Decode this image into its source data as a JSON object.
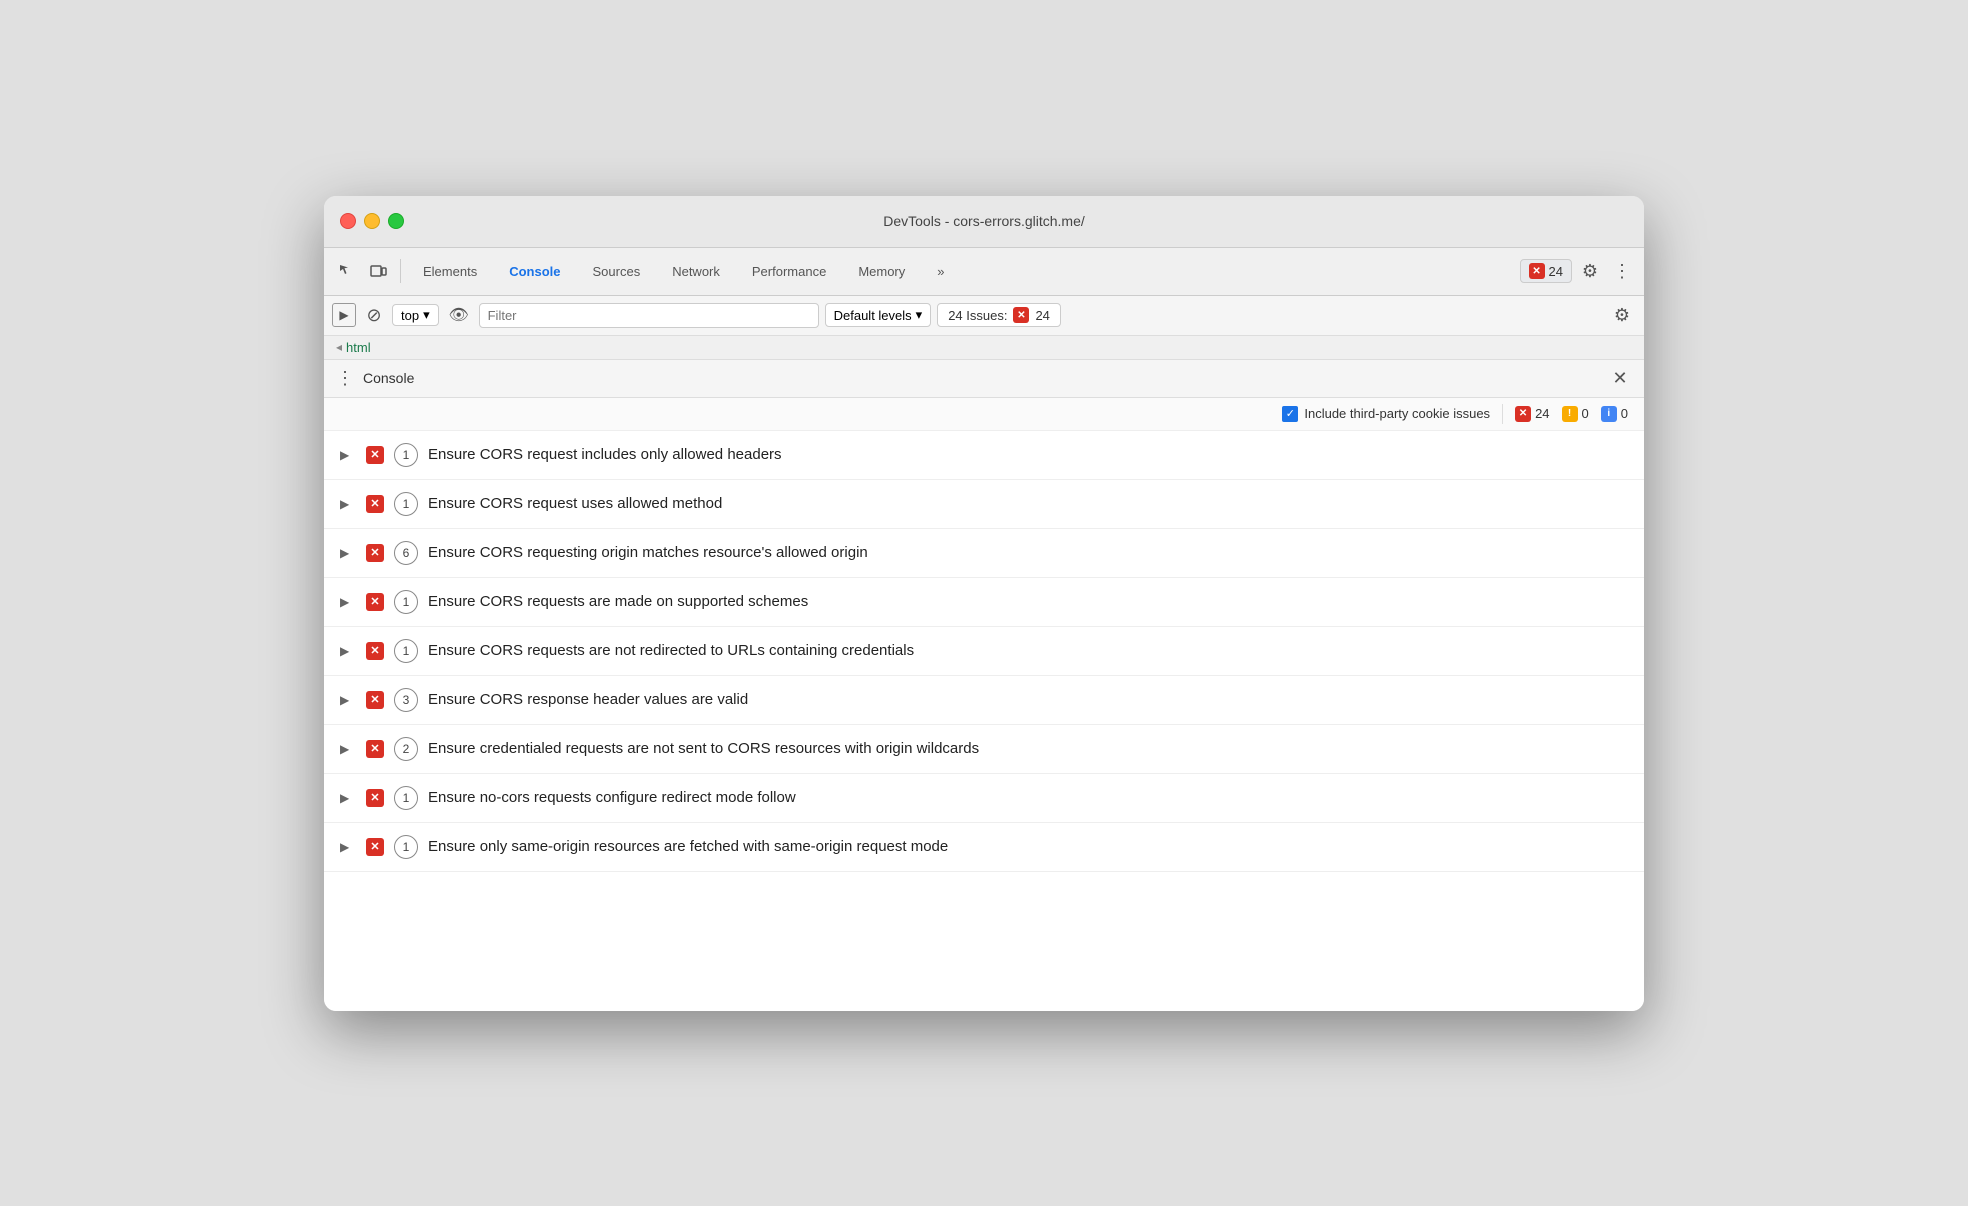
{
  "window": {
    "title": "DevTools - cors-errors.glitch.me/"
  },
  "toolbar": {
    "tabs": [
      {
        "label": "Elements",
        "active": false
      },
      {
        "label": "Console",
        "active": true
      },
      {
        "label": "Sources",
        "active": false
      },
      {
        "label": "Network",
        "active": false
      },
      {
        "label": "Performance",
        "active": false
      },
      {
        "label": "Memory",
        "active": false
      }
    ],
    "more_tabs": "»",
    "error_count": "24",
    "gear_label": "⚙",
    "more_label": "⋮"
  },
  "console_toolbar": {
    "context": "top",
    "filter_placeholder": "Filter",
    "levels": "Default levels",
    "issues_label": "24 Issues:",
    "issues_count": "24"
  },
  "breadcrumb": {
    "arrow": "◂",
    "item": "html"
  },
  "issues_panel": {
    "title": "Console",
    "include_third_party": "Include third-party cookie issues",
    "error_count": "24",
    "warn_count": "0",
    "info_count": "0",
    "items": [
      {
        "count": 1,
        "text": "Ensure CORS request includes only allowed headers"
      },
      {
        "count": 1,
        "text": "Ensure CORS request uses allowed method"
      },
      {
        "count": 6,
        "text": "Ensure CORS requesting origin matches resource's allowed origin"
      },
      {
        "count": 1,
        "text": "Ensure CORS requests are made on supported schemes"
      },
      {
        "count": 1,
        "text": "Ensure CORS requests are not redirected to URLs containing credentials"
      },
      {
        "count": 3,
        "text": "Ensure CORS response header values are valid"
      },
      {
        "count": 2,
        "text": "Ensure credentialed requests are not sent to CORS resources with origin wildcards"
      },
      {
        "count": 1,
        "text": "Ensure no-cors requests configure redirect mode follow"
      },
      {
        "count": 1,
        "text": "Ensure only same-origin resources are fetched with same-origin request mode"
      }
    ]
  }
}
